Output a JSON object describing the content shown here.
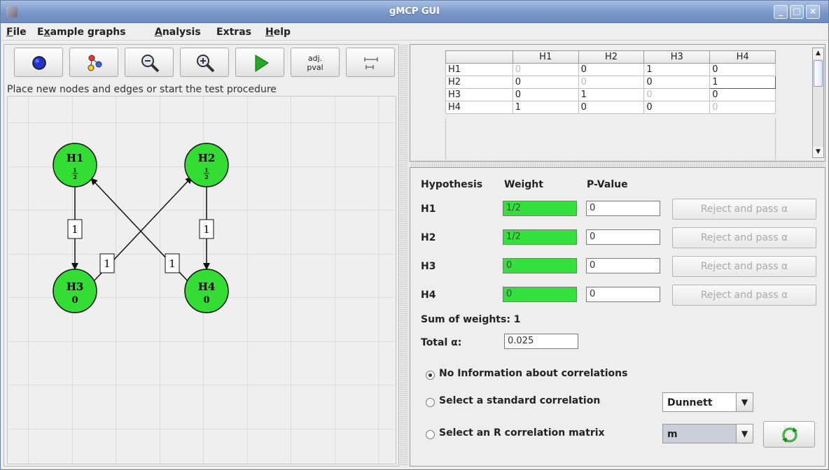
{
  "window": {
    "title": "gMCP GUI",
    "controls": [
      "_",
      "□",
      "×"
    ]
  },
  "menu": {
    "items": [
      {
        "label": "File",
        "mnemonic": "F"
      },
      {
        "label": "Example graphs",
        "mnemonic": "x"
      },
      {
        "label": "Analysis",
        "mnemonic": "A"
      },
      {
        "label": "Extras",
        "mnemonic": ""
      },
      {
        "label": "Help",
        "mnemonic": "H"
      }
    ]
  },
  "toolbar": {
    "buttons": [
      "new-node-icon",
      "new-edge-icon",
      "zoom-out-icon",
      "zoom-in-icon",
      "start-test-icon",
      "adj-pval",
      "layout-icon"
    ],
    "adj_pval_line1": "adj.",
    "adj_pval_line2": "pval"
  },
  "status_text": "Place new nodes and edges or start the test procedure",
  "graph": {
    "nodes": [
      {
        "name": "H1",
        "weight": "1/2"
      },
      {
        "name": "H2",
        "weight": "1/2"
      },
      {
        "name": "H3",
        "weight": "0"
      },
      {
        "name": "H4",
        "weight": "0"
      }
    ],
    "edges": [
      {
        "from": "H1",
        "to": "H3",
        "label": "1"
      },
      {
        "from": "H2",
        "to": "H4",
        "label": "1"
      },
      {
        "from": "H3",
        "to": "H2",
        "label": "1"
      },
      {
        "from": "H4",
        "to": "H1",
        "label": "1"
      }
    ],
    "node_color": "#33dd33"
  },
  "matrix": {
    "columns": [
      "",
      "H1",
      "H2",
      "H3",
      "H4"
    ],
    "rows": [
      {
        "label": "H1",
        "cells": [
          "0",
          "0",
          "1",
          "0"
        ]
      },
      {
        "label": "H2",
        "cells": [
          "0",
          "0",
          "0",
          "1"
        ]
      },
      {
        "label": "H3",
        "cells": [
          "0",
          "1",
          "0",
          "0"
        ]
      },
      {
        "label": "H4",
        "cells": [
          "1",
          "0",
          "0",
          "0"
        ]
      }
    ]
  },
  "hypotheses": {
    "headers": {
      "hypothesis": "Hypothesis",
      "weight": "Weight",
      "pvalue": "P-Value"
    },
    "rows": [
      {
        "name": "H1",
        "weight": "1/2",
        "pvalue": "0",
        "button": "Reject and pass α"
      },
      {
        "name": "H2",
        "weight": "1/2",
        "pvalue": "0",
        "button": "Reject and pass α"
      },
      {
        "name": "H3",
        "weight": "0",
        "pvalue": "0",
        "button": "Reject and pass α"
      },
      {
        "name": "H4",
        "weight": "0",
        "pvalue": "0",
        "button": "Reject and pass α"
      }
    ],
    "sum_label": "Sum of weights: 1",
    "total_alpha_label": "Total α:",
    "total_alpha_value": "0.025"
  },
  "correlation": {
    "options": [
      {
        "label": "No Information about correlations",
        "selected": true
      },
      {
        "label": "Select a standard correlation",
        "selected": false
      },
      {
        "label": "Select an R correlation matrix",
        "selected": false
      }
    ],
    "standard_value": "Dunnett",
    "r_matrix_value": "m"
  }
}
